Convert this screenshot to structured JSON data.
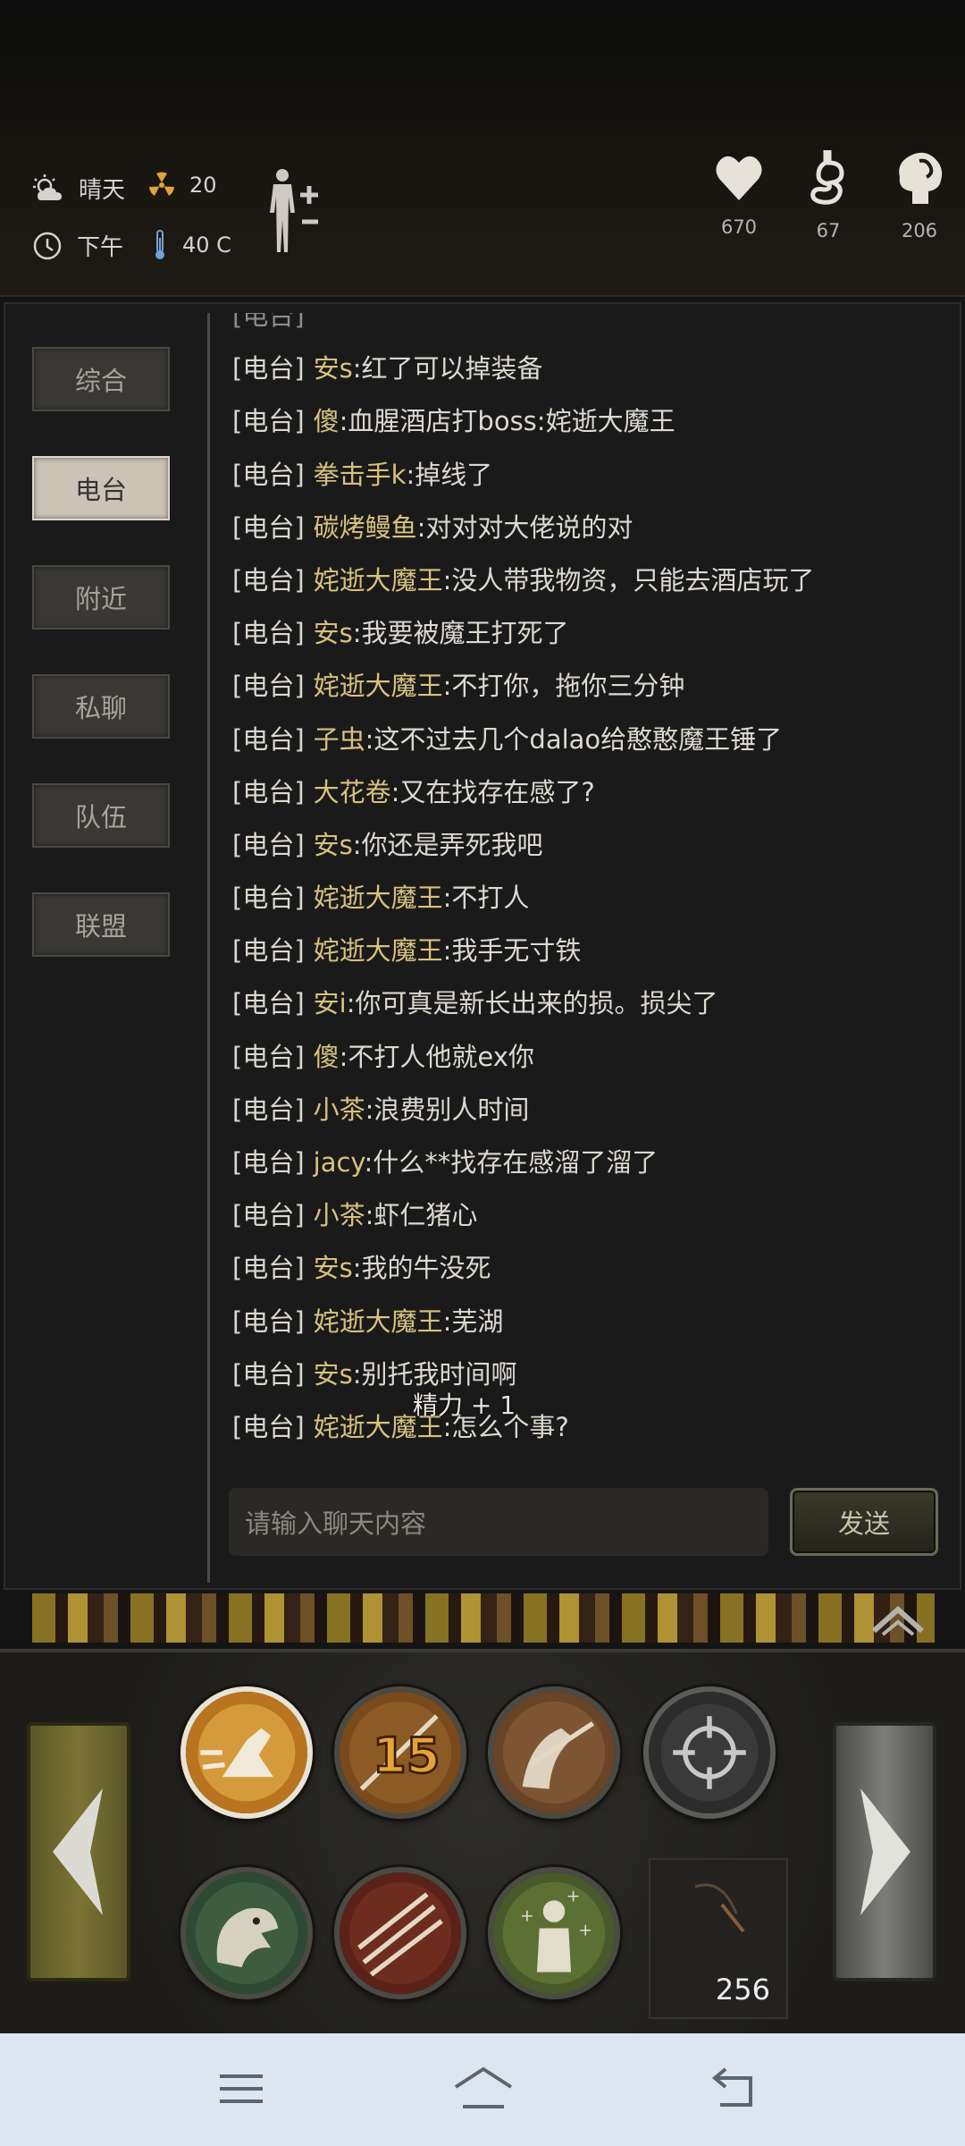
{
  "status": {
    "weather": "晴天",
    "radiation": "20",
    "time_of_day": "下午",
    "temperature": "40 C"
  },
  "vitals": [
    {
      "icon": "heart-icon",
      "value": "670"
    },
    {
      "icon": "stomach-icon",
      "value": "67"
    },
    {
      "icon": "brain-icon",
      "value": "206"
    }
  ],
  "tabs": [
    {
      "label": "综合",
      "active": false
    },
    {
      "label": "电台",
      "active": true
    },
    {
      "label": "附近",
      "active": false
    },
    {
      "label": "私聊",
      "active": false
    },
    {
      "label": "队伍",
      "active": false
    },
    {
      "label": "联盟",
      "active": false
    }
  ],
  "messages": [
    {
      "channel": "[电台]",
      "name": "安s",
      "text": ":红了可以掉装备"
    },
    {
      "channel": "[电台]",
      "name": "傻",
      "text": ":血腥酒店打boss:姹逝大魔王"
    },
    {
      "channel": "[电台]",
      "name": "拳击手k",
      "text": ":掉线了"
    },
    {
      "channel": "[电台]",
      "name": "碳烤鳗鱼",
      "text": ":对对对大佬说的对"
    },
    {
      "channel": "[电台]",
      "name": "姹逝大魔王",
      "text": ":没人带我物资，只能去酒店玩了"
    },
    {
      "channel": "[电台]",
      "name": "安s",
      "text": ":我要被魔王打死了"
    },
    {
      "channel": "[电台]",
      "name": "姹逝大魔王",
      "text": ":不打你，拖你三分钟"
    },
    {
      "channel": "[电台]",
      "name": "子虫",
      "text": ":这不过去几个dalao给憨憨魔王锤了"
    },
    {
      "channel": "[电台]",
      "name": "大花卷",
      "text": ":又在找存在感了?"
    },
    {
      "channel": "[电台]",
      "name": "安s",
      "text": ":你还是弄死我吧"
    },
    {
      "channel": "[电台]",
      "name": "姹逝大魔王",
      "text": ":不打人"
    },
    {
      "channel": "[电台]",
      "name": "姹逝大魔王",
      "text": ":我手无寸铁"
    },
    {
      "channel": "[电台]",
      "name": "安i",
      "text": ":你可真是新长出来的损。损尖了"
    },
    {
      "channel": "[电台]",
      "name": "傻",
      "text": ":不打人他就ex你"
    },
    {
      "channel": "[电台]",
      "name": "小茶",
      "text": ":浪费别人时间"
    },
    {
      "channel": "[电台]",
      "name": "jacy",
      "text": ":什么**找存在感溜了溜了"
    },
    {
      "channel": "[电台]",
      "name": "小茶",
      "text": ":虾仁猪心"
    },
    {
      "channel": "[电台]",
      "name": "安s",
      "text": ":我的牛没死"
    },
    {
      "channel": "[电台]",
      "name": "姹逝大魔王",
      "text": ":芜湖"
    },
    {
      "channel": "[电台]",
      "name": "安s",
      "text": ":别托我时间啊"
    },
    {
      "channel": "[电台]",
      "name": "姹逝大魔王",
      "text": ":怎么个事?"
    }
  ],
  "float_text": "精力 + 1",
  "input": {
    "placeholder": "请输入聊天内容"
  },
  "send_label": "发送",
  "skill_countdown": "15",
  "item_count": "256",
  "colors": {
    "name": "#d8c27e",
    "text": "#ddd9d1",
    "tab_active": "#cbc3b6"
  }
}
